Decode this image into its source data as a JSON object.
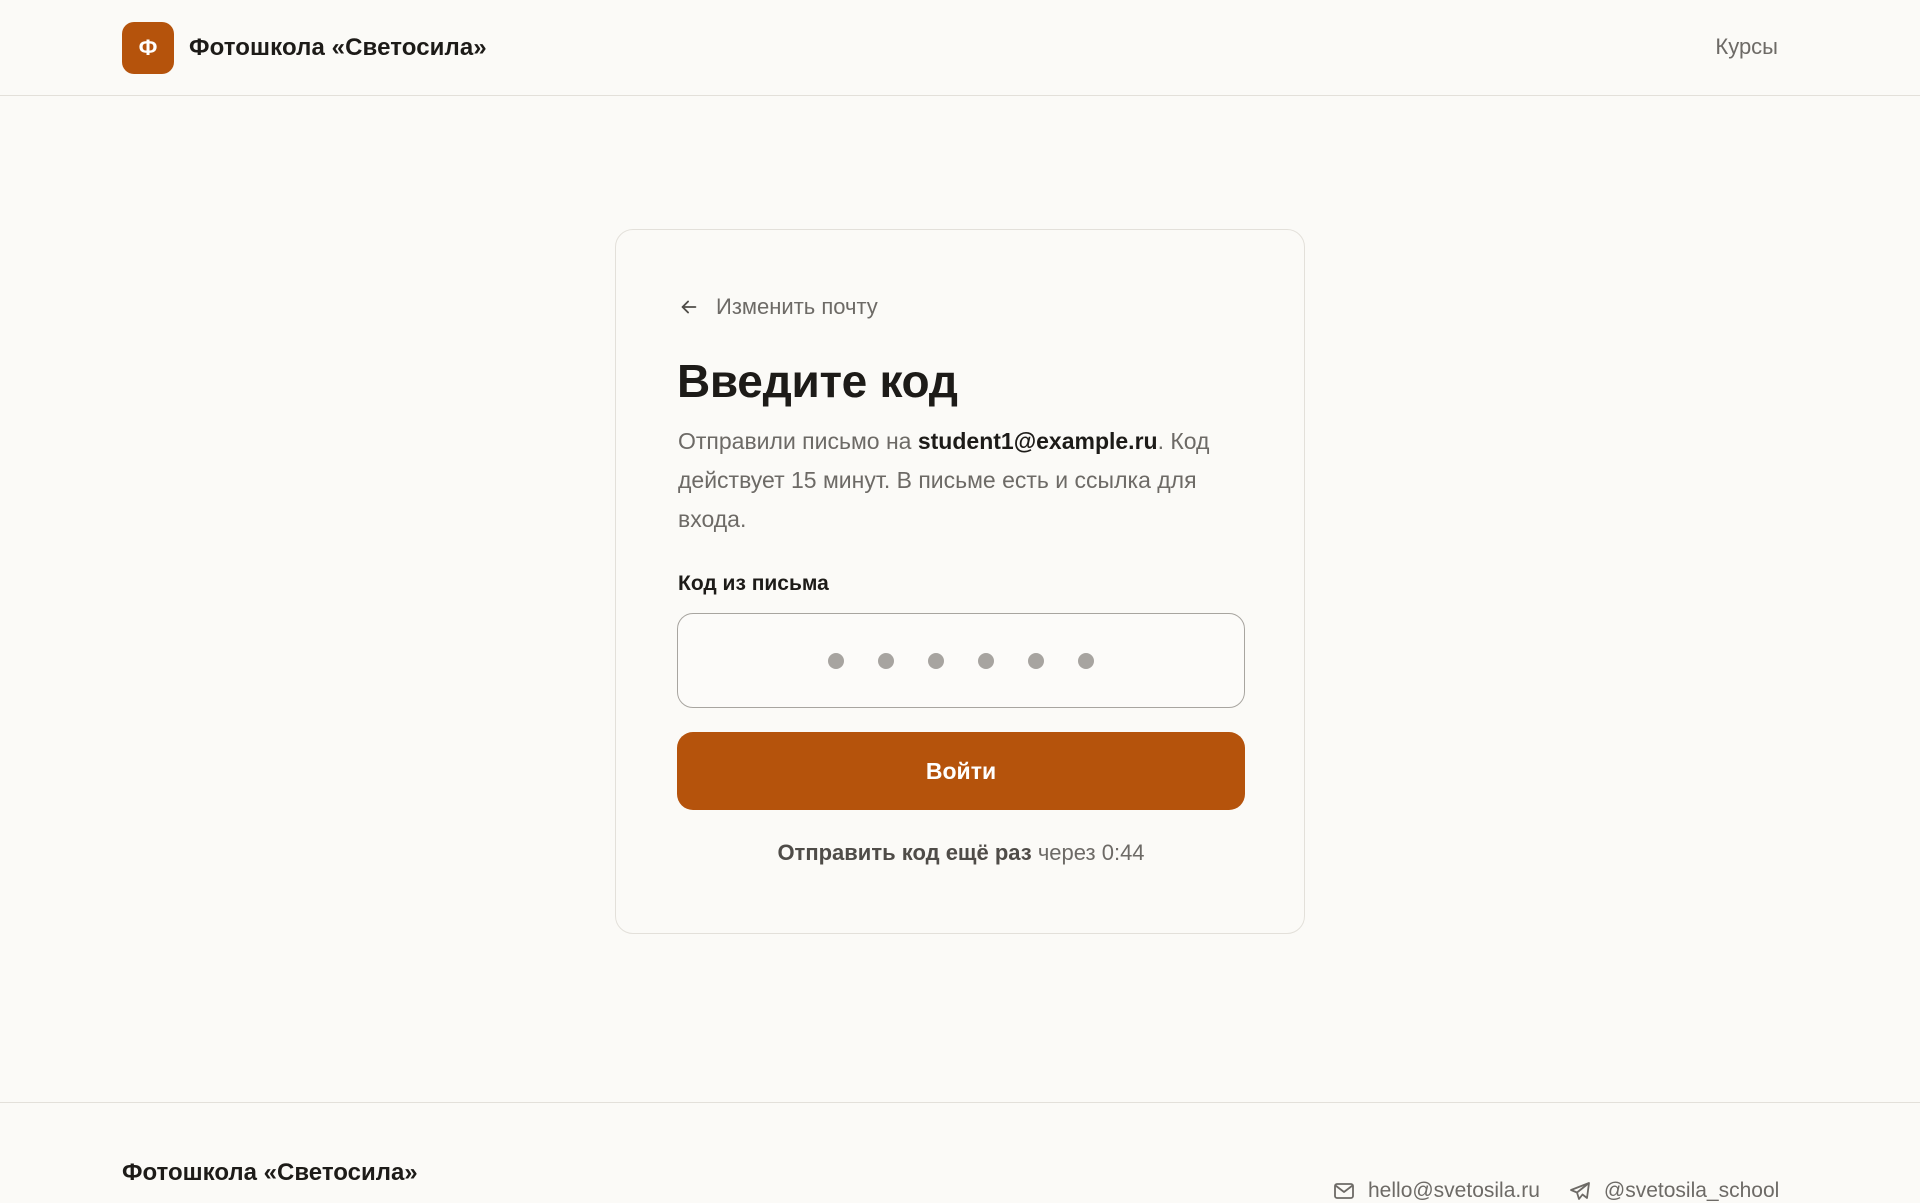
{
  "header": {
    "logo_letter": "Ф",
    "brand_name": "Фотошкола «Светосила»",
    "nav_courses": "Курсы"
  },
  "card": {
    "back_label": "Изменить почту",
    "title": "Введите код",
    "desc_prefix": "Отправили письмо на ",
    "email": "student1@example.ru",
    "desc_suffix": ". Код действует 15 минут. В письме есть и ссылка для входа.",
    "code_label": "Код из письма",
    "code_placeholder": "● ● ● ● ● ●",
    "code_digits": 6,
    "submit_label": "Войти",
    "resend_link": "Отправить код ещё раз",
    "resend_timer": " через 0:44"
  },
  "footer": {
    "brand_name": "Фотошкола «Светосила»",
    "email": "hello@svetosila.ru",
    "telegram": "@svetosila_school"
  },
  "icons": {
    "back": "arrow-left-icon",
    "mail": "mail-icon",
    "telegram": "telegram-icon"
  },
  "colors": {
    "accent": "#b5530c",
    "background": "#fbfaf7",
    "text": "#1d1b18",
    "muted": "#6d6a66"
  }
}
